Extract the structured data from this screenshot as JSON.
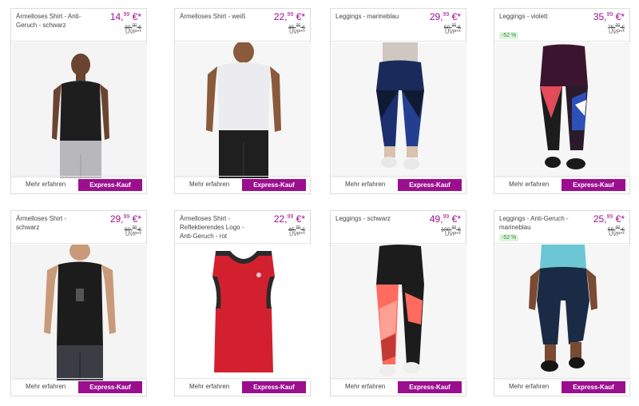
{
  "products": [
    {
      "title": "Ärmelloses Shirt - Anti-Geruch - schwarz",
      "price_main": "14",
      "price_cents": "99",
      "price_suffix": " €*",
      "old_price_main": "30",
      "old_price_cents": "00",
      "old_price_suffix": " €",
      "uvp": "UVP**",
      "badge": "",
      "more": "Mehr erfahren",
      "express": "Express-Kauf",
      "image": "man-black-sleeveless"
    },
    {
      "title": "Ärmelloses Shirt - weiß",
      "price_main": "22",
      "price_cents": "99",
      "price_suffix": " €*",
      "old_price_main": "45",
      "old_price_cents": "00",
      "old_price_suffix": " €",
      "uvp": "UVP**",
      "badge": "",
      "more": "Mehr erfahren",
      "express": "Express-Kauf",
      "image": "man-white-sleeveless"
    },
    {
      "title": "Leggings - marineblau",
      "price_main": "29",
      "price_cents": "99",
      "price_suffix": " €*",
      "old_price_main": "50",
      "old_price_cents": "00",
      "old_price_suffix": " €",
      "uvp": "UVP**",
      "badge": "",
      "more": "Mehr erfahren",
      "express": "Express-Kauf",
      "image": "leggings-navy"
    },
    {
      "title": "Leggings - violett",
      "price_main": "35",
      "price_cents": "99",
      "price_suffix": " €*",
      "old_price_main": "75",
      "old_price_cents": "00",
      "old_price_suffix": " €",
      "uvp": "UVP**",
      "badge": "-52 %",
      "more": "Mehr erfahren",
      "express": "Express-Kauf",
      "image": "leggings-violet"
    },
    {
      "title": "Ärmelloses Shirt - schwarz",
      "price_main": "29",
      "price_cents": "99",
      "price_suffix": " €*",
      "old_price_main": "60",
      "old_price_cents": "00",
      "old_price_suffix": " €",
      "uvp": "UVP**",
      "badge": "",
      "more": "Mehr erfahren",
      "express": "Express-Kauf",
      "image": "man-black-tank"
    },
    {
      "title": "Ärmelloses Shirt - Reflektierendes Logo - Anti-Geruch - rot",
      "price_main": "22",
      "price_cents": "99",
      "price_suffix": " €*",
      "old_price_main": "45",
      "old_price_cents": "00",
      "old_price_suffix": " €",
      "uvp": "UVP**",
      "badge": "",
      "more": "Mehr erfahren",
      "express": "Express-Kauf",
      "image": "red-tank"
    },
    {
      "title": "Leggings - schwarz",
      "price_main": "49",
      "price_cents": "99",
      "price_suffix": " €*",
      "old_price_main": "100",
      "old_price_cents": "00",
      "old_price_suffix": " €",
      "uvp": "UVP**",
      "badge": "",
      "more": "Mehr erfahren",
      "express": "Express-Kauf",
      "image": "leggings-black-coral"
    },
    {
      "title": "Leggings - Anti-Geruch - marineblau",
      "price_main": "25",
      "price_cents": "99",
      "price_suffix": " €*",
      "old_price_main": "55",
      "old_price_cents": "00",
      "old_price_suffix": " €",
      "uvp": "UVP**",
      "badge": "-52 %",
      "more": "Mehr erfahren",
      "express": "Express-Kauf",
      "image": "capri-navy"
    }
  ],
  "colors": {
    "accent": "#9b0f8e",
    "price": "#a10f8f",
    "badge_bg": "#dff3df",
    "badge_text": "#2e8b2e"
  }
}
